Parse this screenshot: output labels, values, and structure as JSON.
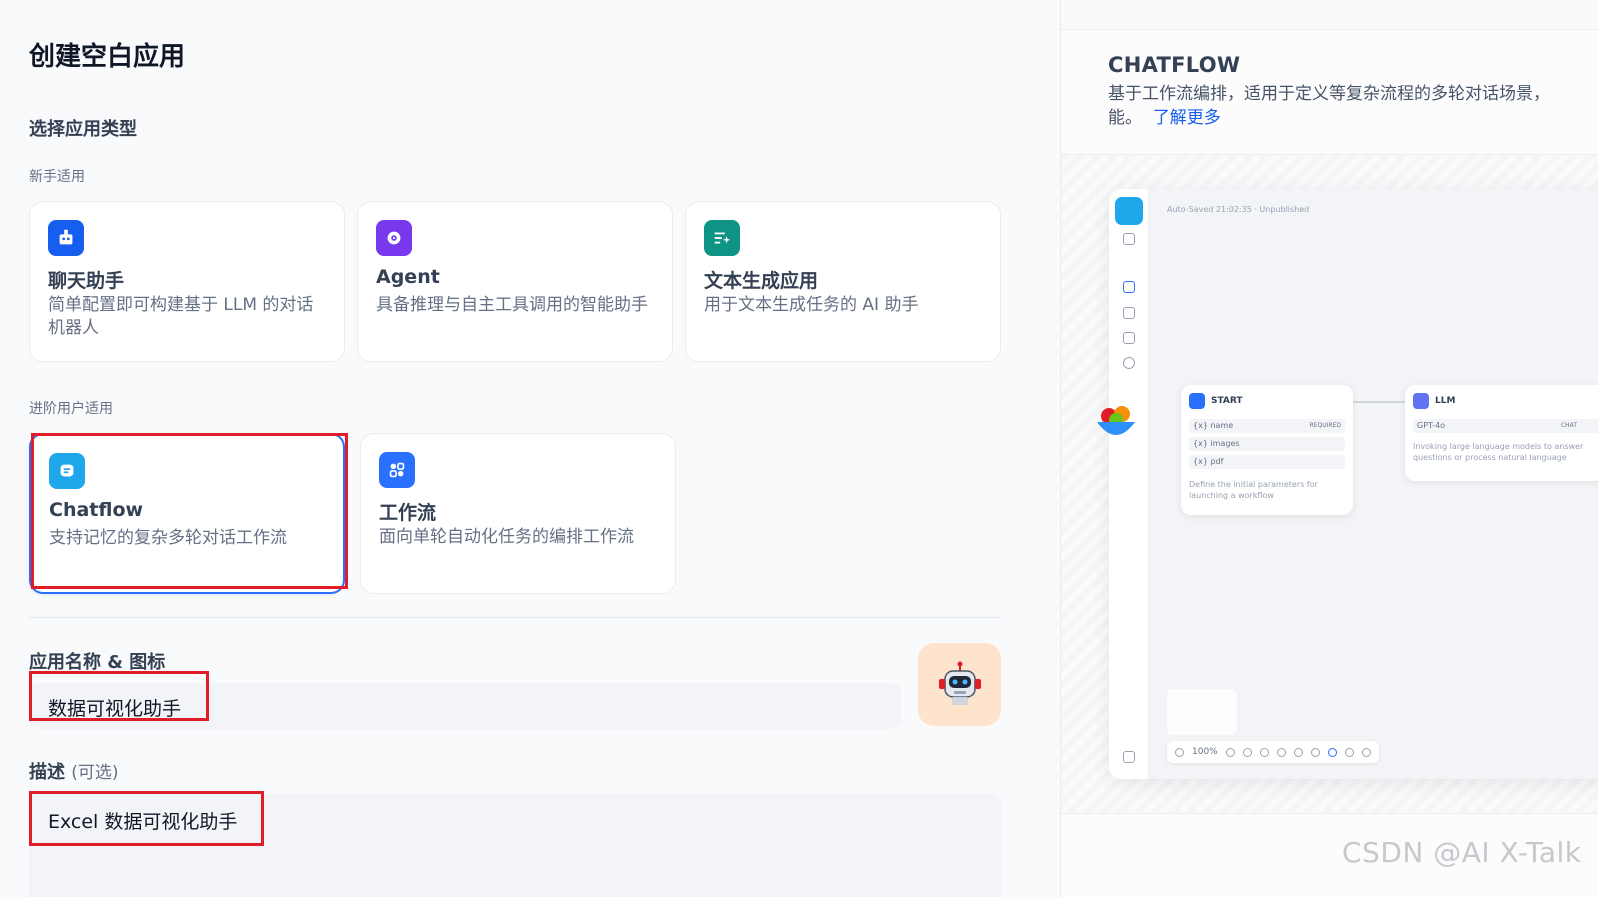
{
  "page": {
    "title": "创建空白应用",
    "type_section_title": "选择应用类型",
    "beginner_label": "新手适用",
    "advanced_label": "进阶用户适用"
  },
  "app_types": {
    "chatbot": {
      "title": "聊天助手",
      "desc": "简单配置即可构建基于 LLM 的对话机器人",
      "icon": "chat-bot-icon",
      "color": "#155eef"
    },
    "agent": {
      "title": "Agent",
      "desc": "具备推理与自主工具调用的智能助手",
      "icon": "agent-icon",
      "color": "#7839ee"
    },
    "text_gen": {
      "title": "文本生成应用",
      "desc": "用于文本生成任务的 AI 助手",
      "icon": "text-generation-icon",
      "color": "#0e9384"
    },
    "chatflow": {
      "title": "Chatflow",
      "desc": "支持记忆的复杂多轮对话工作流",
      "icon": "chatflow-icon",
      "color": "#1fa7ec",
      "selected": true
    },
    "workflow": {
      "title": "工作流",
      "desc": "面向单轮自动化任务的编排工作流",
      "icon": "workflow-icon",
      "color": "#2970ff"
    }
  },
  "form": {
    "name_label": "应用名称 & 图标",
    "name_value": "数据可视化助手",
    "desc_label": "描述",
    "desc_optional": "(可选)",
    "desc_value": "Excel 数据可视化助手",
    "avatar_icon": "robot-avatar-icon"
  },
  "preview": {
    "title": "CHATFLOW",
    "desc_line1": "基于工作流编排，适用于定义等复杂流程的多轮对话场景，",
    "desc_line2": "能。",
    "learn_more": "了解更多",
    "auto_saved": "Auto-Saved 21:02:35 · Unpublished",
    "start_node": {
      "title": "START",
      "vars": [
        "{x} name",
        "{x} images",
        "{x} pdf"
      ],
      "required": "REQUIRED",
      "note": "Define the initial parameters for launching a workflow"
    },
    "llm_node": {
      "title": "LLM",
      "model": "GPT-4o",
      "mode": "CHAT",
      "note": "Invoking large language models to answer questions or process natural language"
    },
    "zoom": "100%"
  },
  "watermark": "CSDN @AI X-Talk"
}
